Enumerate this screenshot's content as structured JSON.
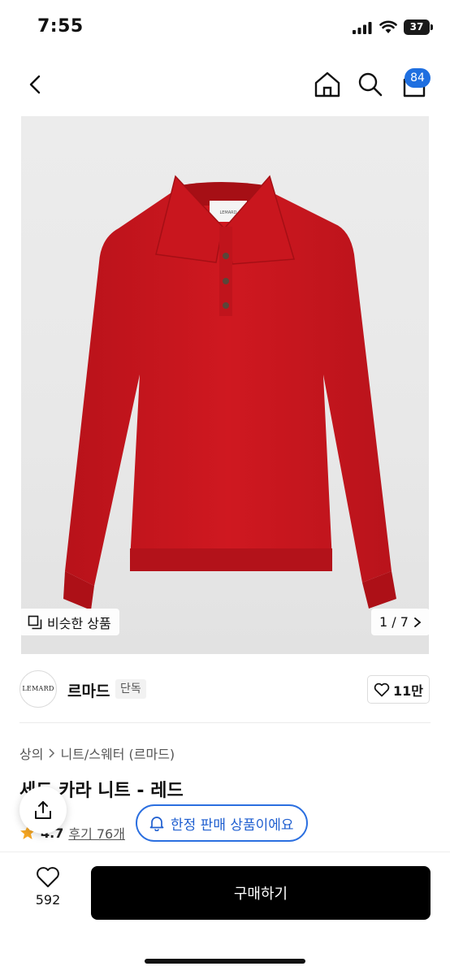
{
  "status_bar": {
    "time": "7:55",
    "battery": "37",
    "icons": [
      "signal-icon",
      "wifi-icon",
      "battery-icon"
    ]
  },
  "nav": {
    "icons": [
      "back-icon",
      "home-icon",
      "search-icon",
      "cart-icon"
    ],
    "cart_badge": "84"
  },
  "gallery": {
    "similar_label": "비슷한 상품",
    "page_indicator": "1 / 7",
    "garment_label": "LEMARD"
  },
  "brand": {
    "logo_text": "LEMARD",
    "name": "르마드",
    "badge": "단독",
    "likes": "11만"
  },
  "product": {
    "breadcrumb": [
      "상의",
      "니트/스웨터 (르마드)"
    ],
    "title": "세드 카라 니트 - 레드",
    "rating": "4.7",
    "reviews": "후기 76개",
    "limited_notice": "한정 판매 상품이에요"
  },
  "bottom_bar": {
    "wish_count": "592",
    "buy_label": "구매하기"
  },
  "colors": {
    "accent": "#1f6fe0",
    "garment": "#c8161d",
    "star": "#f5a623",
    "buy_button": "#000000"
  }
}
